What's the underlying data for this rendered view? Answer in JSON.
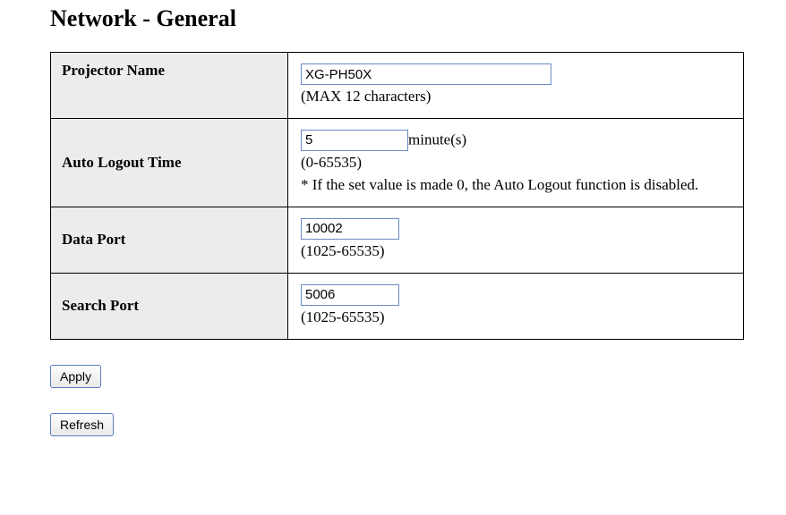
{
  "page": {
    "title": "Network - General"
  },
  "fields": {
    "projector_name": {
      "label": "Projector Name",
      "value": "XG-PH50X",
      "hint": "(MAX 12 characters)"
    },
    "auto_logout_time": {
      "label": "Auto Logout Time",
      "value": "5",
      "unit": "minute(s)",
      "range": "(0-65535)",
      "note": "* If the set value is made 0, the Auto Logout function is disabled."
    },
    "data_port": {
      "label": "Data Port",
      "value": "10002",
      "range": "(1025-65535)"
    },
    "search_port": {
      "label": "Search Port",
      "value": "5006",
      "range": "(1025-65535)"
    }
  },
  "buttons": {
    "apply": "Apply",
    "refresh": "Refresh"
  }
}
